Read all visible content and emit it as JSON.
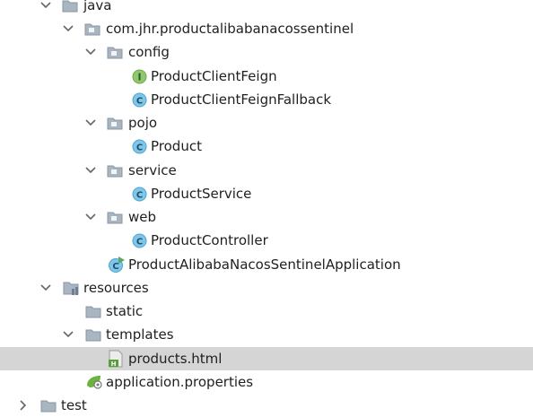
{
  "project_tree": {
    "items": [
      {
        "label": "java",
        "icon": "folder-icon",
        "expanded": true
      },
      {
        "label": "com.jhr.productalibabanacossentinel",
        "icon": "package-icon",
        "expanded": true
      },
      {
        "label": "config",
        "icon": "package-icon",
        "expanded": true
      },
      {
        "label": "ProductClientFeign",
        "icon": "interface-icon"
      },
      {
        "label": "ProductClientFeignFallback",
        "icon": "class-icon"
      },
      {
        "label": "pojo",
        "icon": "package-icon",
        "expanded": true
      },
      {
        "label": "Product",
        "icon": "class-icon"
      },
      {
        "label": "service",
        "icon": "package-icon",
        "expanded": true
      },
      {
        "label": "ProductService",
        "icon": "class-icon"
      },
      {
        "label": "web",
        "icon": "package-icon",
        "expanded": true
      },
      {
        "label": "ProductController",
        "icon": "class-icon"
      },
      {
        "label": "ProductAlibabaNacosSentinelApplication",
        "icon": "spring-boot-app-icon"
      },
      {
        "label": "resources",
        "icon": "resources-folder-icon",
        "expanded": true
      },
      {
        "label": "static",
        "icon": "folder-icon"
      },
      {
        "label": "templates",
        "icon": "folder-icon",
        "expanded": true
      },
      {
        "label": "products.html",
        "icon": "html-file-icon",
        "selected": true
      },
      {
        "label": "application.properties",
        "icon": "spring-properties-icon"
      },
      {
        "label": "test",
        "icon": "folder-icon",
        "expanded": false
      }
    ]
  },
  "colors": {
    "selection": "#d5d5d5",
    "folder": "#a9b5c1",
    "class_icon": "#7fc6e8",
    "interface_icon": "#8fc86f",
    "spring_green": "#6db33f"
  }
}
